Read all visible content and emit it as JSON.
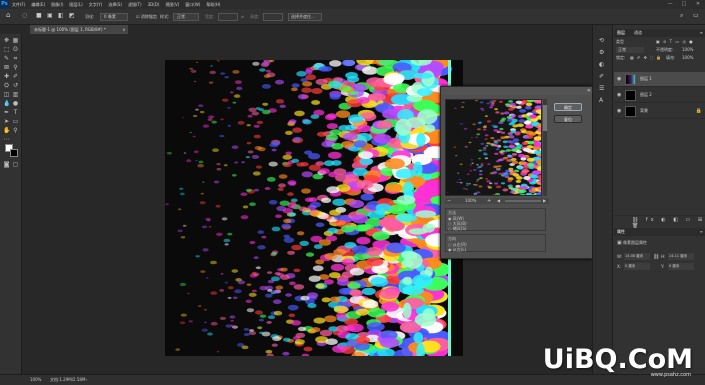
{
  "app": {
    "logo_text": "Ps"
  },
  "menubar": {
    "items": [
      "文件(F)",
      "编辑(E)",
      "图像(I)",
      "图层(L)",
      "文字(Y)",
      "选择(S)",
      "滤镜(T)",
      "3D(D)",
      "视图(V)",
      "窗口(W)",
      "帮助(H)"
    ],
    "min_label": "—",
    "max_label": "□",
    "close_label": "✕"
  },
  "options": {
    "feather_label": "羽化:",
    "feather_value": "0 像素",
    "antialias_label": "消除锯齿",
    "style_label": "样式:",
    "style_value": "正常",
    "width_label": "宽度:",
    "height_label": "高度:",
    "select_mask_label": "选择并遮住..."
  },
  "document": {
    "tab_title": "未标题-1 @ 100% (图层 1, RGB/8#) *",
    "close_icon": "x"
  },
  "dialog": {
    "ok_label": "确定",
    "cancel_label": "复位",
    "zoom_value": "100%",
    "method_heading": "方法",
    "method_options": [
      "风(W)",
      "大风(B)",
      "飓风(S)"
    ],
    "direction_heading": "方向",
    "direction_options": [
      "从右(R)",
      "从左(L)"
    ]
  },
  "panels": {
    "tabs": [
      "图层",
      "通道",
      "路径"
    ],
    "kind_label": "类型",
    "blend_mode": "正常",
    "opacity_label": "不透明度:",
    "opacity_value": "100%",
    "lock_label": "锁定:",
    "fill_label": "填充:",
    "fill_value": "100%",
    "layers": [
      "图层 1",
      "图层 2",
      "背景"
    ],
    "props_title": "属性",
    "props_heading": "像素图层属性",
    "w_label": "W:",
    "w_value": "14.08 厘米",
    "h_label": "H:",
    "h_value": "14.11 厘米",
    "x_label": "X:",
    "x_value": "0 厘米",
    "y_label": "Y:",
    "y_value": "0 厘米"
  },
  "statusbar": {
    "zoom": "100%",
    "doc_info": "文档:1.29M/2.58M"
  },
  "watermark": {
    "main": "UiBQ.CoM",
    "sub": "www.psahz.com"
  },
  "colors": {
    "accent": "#31a8ff",
    "panel": "#323232",
    "background": "#282828"
  }
}
